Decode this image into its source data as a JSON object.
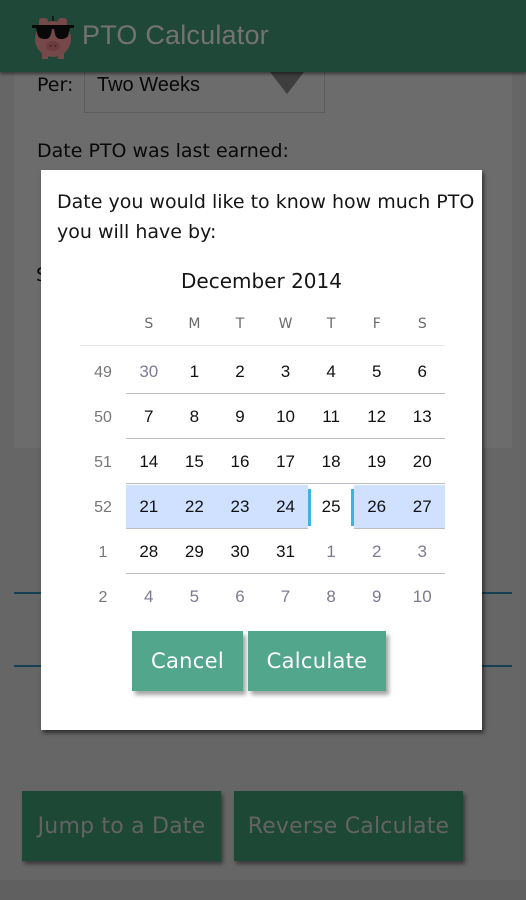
{
  "app": {
    "title": "PTO Calculator",
    "logo_icon": "piggy-bank-sunglasses-icon",
    "per_label": "Per:",
    "per_value": "Two Weeks",
    "date_last_earned_label": "Date PTO was last earned:",
    "partial_label": "S",
    "buttons": {
      "jump": "Jump to a Date",
      "reverse": "Reverse Calculate"
    }
  },
  "dialog": {
    "prompt": "Date you would like to know how much PTO you will have by:",
    "month_title": "December 2014",
    "weekdays": [
      "S",
      "M",
      "T",
      "W",
      "T",
      "F",
      "S"
    ],
    "weeks": [
      {
        "week": "49",
        "days": [
          {
            "d": "30",
            "other": true
          },
          {
            "d": "1"
          },
          {
            "d": "2"
          },
          {
            "d": "3"
          },
          {
            "d": "4"
          },
          {
            "d": "5"
          },
          {
            "d": "6"
          }
        ]
      },
      {
        "week": "50",
        "days": [
          {
            "d": "7"
          },
          {
            "d": "8"
          },
          {
            "d": "9"
          },
          {
            "d": "10"
          },
          {
            "d": "11"
          },
          {
            "d": "12"
          },
          {
            "d": "13"
          }
        ]
      },
      {
        "week": "51",
        "days": [
          {
            "d": "14"
          },
          {
            "d": "15"
          },
          {
            "d": "16"
          },
          {
            "d": "17"
          },
          {
            "d": "18"
          },
          {
            "d": "19"
          },
          {
            "d": "20"
          }
        ]
      },
      {
        "week": "52",
        "selected": true,
        "days": [
          {
            "d": "21"
          },
          {
            "d": "22"
          },
          {
            "d": "23"
          },
          {
            "d": "24"
          },
          {
            "d": "25",
            "today": true
          },
          {
            "d": "26"
          },
          {
            "d": "27"
          }
        ]
      },
      {
        "week": "1",
        "days": [
          {
            "d": "28"
          },
          {
            "d": "29"
          },
          {
            "d": "30"
          },
          {
            "d": "31"
          },
          {
            "d": "1",
            "other": true
          },
          {
            "d": "2",
            "other": true
          },
          {
            "d": "3",
            "other": true
          }
        ]
      },
      {
        "week": "2",
        "days": [
          {
            "d": "4",
            "other": true
          },
          {
            "d": "5",
            "other": true
          },
          {
            "d": "6",
            "other": true
          },
          {
            "d": "7",
            "other": true
          },
          {
            "d": "8",
            "other": true
          },
          {
            "d": "9",
            "other": true
          },
          {
            "d": "10",
            "other": true
          }
        ]
      }
    ],
    "selected_date": "25",
    "cancel_label": "Cancel",
    "calculate_label": "Calculate"
  },
  "colors": {
    "actionbar": "#3f8a6c",
    "button": "#52a68c",
    "selected_week": "#cfe1ff",
    "today_marker": "#3bb4e5"
  }
}
